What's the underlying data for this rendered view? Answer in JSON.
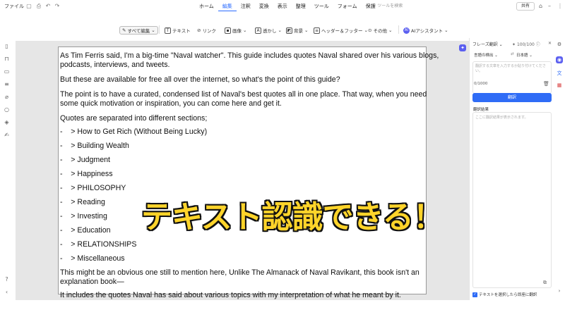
{
  "menubar": {
    "file_label": "ファイル",
    "tabs": [
      "ホーム",
      "編集",
      "注釈",
      "変換",
      "表示",
      "整理",
      "ツール",
      "フォーム",
      "保護"
    ],
    "active_tab": "編集",
    "search_placeholder": "ツールを検索",
    "share_label": "共有"
  },
  "toolbar": {
    "edit_all": "すべて編集",
    "text": "テキスト",
    "link": "リンク",
    "image": "画像",
    "watermark": "透かし",
    "background": "背景",
    "header_footer": "ヘッダー＆フッター",
    "other": "その他",
    "ai_assistant": "AIアシスタント"
  },
  "document": {
    "paragraphs": [
      "As Tim Ferris said, I'm a big-time \"Naval watcher\". This guide includes quotes Naval shared over his various blogs,",
      "podcasts, interviews, and tweets.",
      "But these are available for free all over the internet, so what's the point of this guide?",
      "The point is to have a curated, condensed list of Naval's best quotes all in one place. That way, when you need",
      "some quick motivation or inspiration, you can come here and get it.",
      "Quotes are separated into different sections;"
    ],
    "list_items": [
      "-    > How to Get Rich (Without Being Lucky)",
      "-    > Building Wealth",
      "-    > Judgment",
      "-    > Happiness",
      "-    > PHILOSOPHY",
      "-    > Reading",
      "-    > Investing",
      "-    > Education",
      "-    > RELATIONSHIPS",
      "-    > Miscellaneous"
    ],
    "closing": [
      "This might be an obvious one still to mention here, Unlike The Almanack of Naval Ravikant, this book isn't an",
      "explanation book—",
      "It includes the quotes Naval has said about various topics with my interpretation of what he meant by it."
    ]
  },
  "overlay_caption": "テキスト認識できる！",
  "translate_panel": {
    "mode": "フレーズ翻訳",
    "credits": "100/100",
    "source_lang": "言語の検出",
    "target_lang": "日本語",
    "input_placeholder": "翻訳する文章を入力するか貼り付けてください。",
    "char_count": "0/1000",
    "translate_button": "翻訳",
    "result_label": "翻訳結果",
    "result_placeholder": "ここに翻訳結果が表示されます。",
    "auto_translate_label": "テキストを選択したら即座に翻訳"
  },
  "colors": {
    "accent": "#2f6cf6",
    "caption_fill": "#ffd42a",
    "caption_outline": "#111111"
  }
}
